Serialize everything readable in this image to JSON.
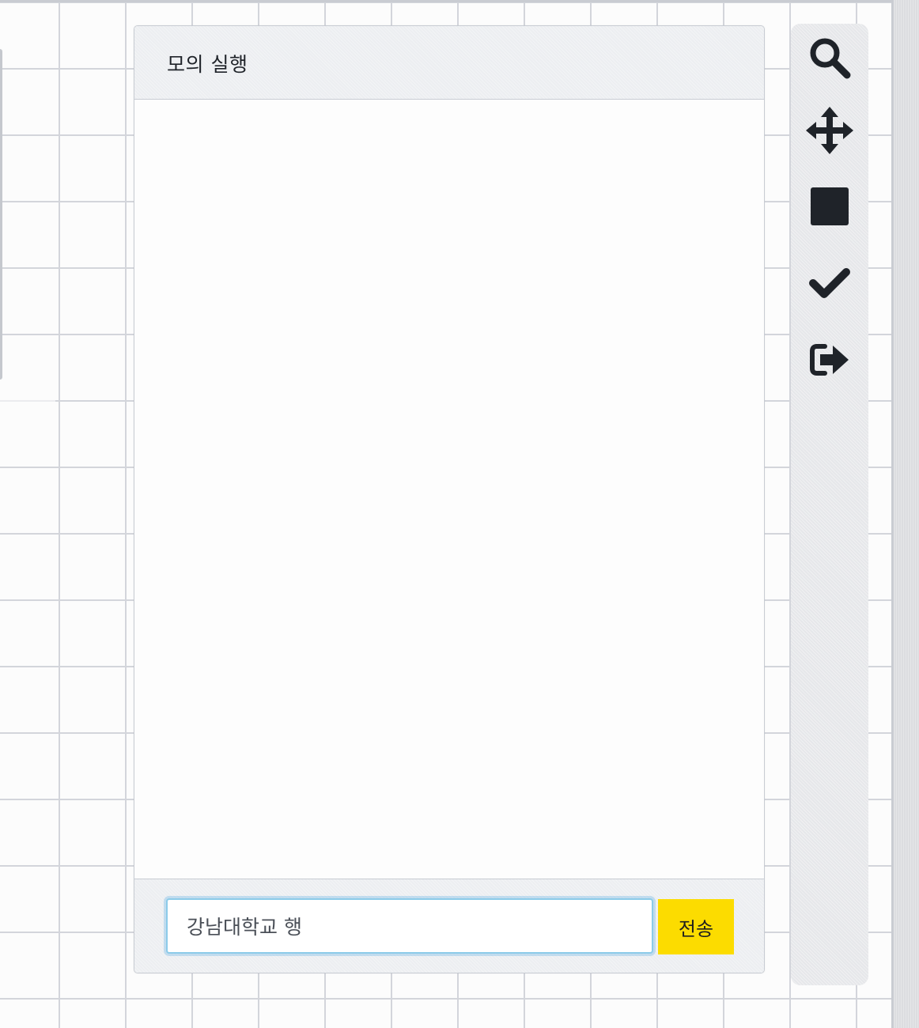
{
  "simulator": {
    "title": "모의 실행",
    "input_value": "강남대학교 행",
    "send_label": "전송"
  },
  "toolbar": {
    "buttons": [
      {
        "icon": "search-icon",
        "label": ""
      },
      {
        "icon": "move-icon",
        "label": ""
      },
      {
        "icon": "stop-icon",
        "label": ""
      },
      {
        "icon": "check-icon",
        "label": ""
      },
      {
        "icon": "sign-out-icon",
        "label": ""
      }
    ]
  },
  "colors": {
    "send_button": "#fcdc00",
    "icon": "#1f2329",
    "input_focus": "#8ccbe9"
  }
}
